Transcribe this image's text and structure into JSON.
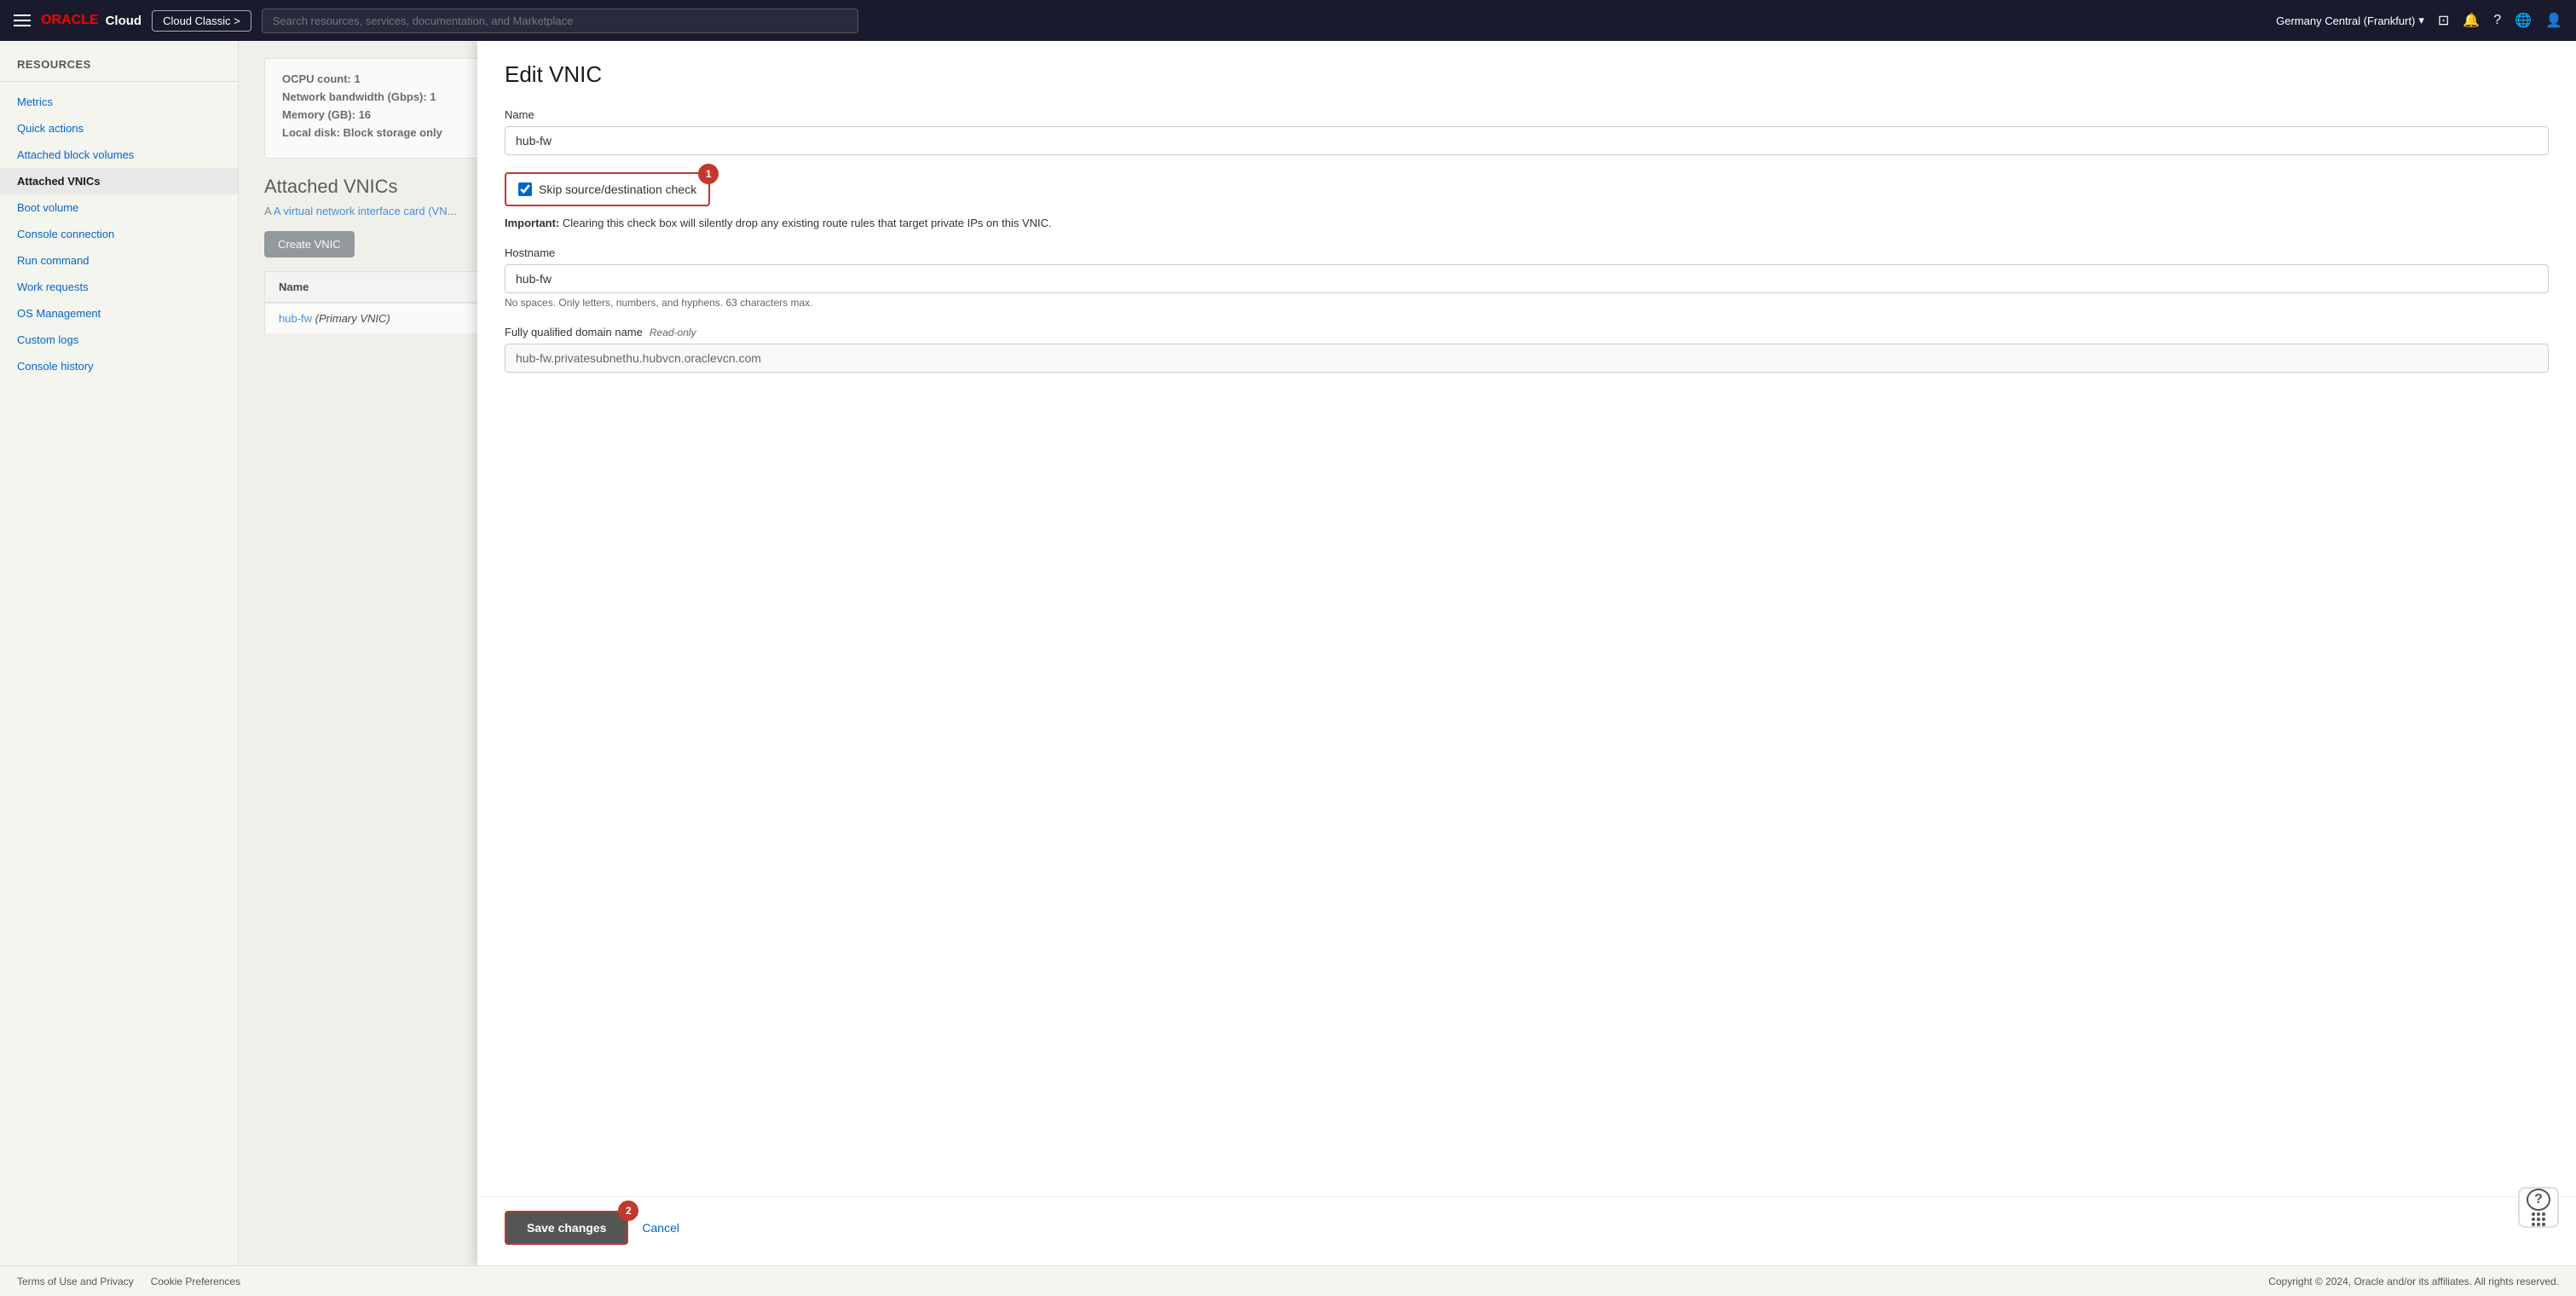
{
  "topNav": {
    "hamburger_label": "Menu",
    "oracle_text": "ORACLE",
    "cloud_text": "Cloud",
    "cloud_classic_btn": "Cloud Classic >",
    "search_placeholder": "Search resources, services, documentation, and Marketplace",
    "region": "Germany Central (Frankfurt)",
    "region_chevron": "▾"
  },
  "sidebar": {
    "resources_label": "Resources",
    "items": [
      {
        "id": "metrics",
        "label": "Metrics",
        "active": false
      },
      {
        "id": "quick-actions",
        "label": "Quick actions",
        "active": false
      },
      {
        "id": "attached-block-volumes",
        "label": "Attached block volumes",
        "active": false
      },
      {
        "id": "attached-vnics",
        "label": "Attached VNICs",
        "active": true
      },
      {
        "id": "boot-volume",
        "label": "Boot volume",
        "active": false
      },
      {
        "id": "console-connection",
        "label": "Console connection",
        "active": false
      },
      {
        "id": "run-command",
        "label": "Run command",
        "active": false
      },
      {
        "id": "work-requests",
        "label": "Work requests",
        "active": false
      },
      {
        "id": "os-management",
        "label": "OS Management",
        "active": false
      },
      {
        "id": "custom-logs",
        "label": "Custom logs",
        "active": false
      },
      {
        "id": "console-history",
        "label": "Console history",
        "active": false
      }
    ]
  },
  "bgContent": {
    "ocpu_label": "OCPU count:",
    "ocpu_value": "1",
    "network_label": "Network bandwidth (Gbps):",
    "network_value": "1",
    "memory_label": "Memory (GB):",
    "memory_value": "16",
    "local_disk_label": "Local disk:",
    "local_disk_value": "Block storage only",
    "attached_vnics_title": "Attached VNICs",
    "attached_vnics_desc": "A virtual network interface card (VN...",
    "create_vnic_btn": "Create VNIC",
    "table_col_name": "Name",
    "vnic_name": "hub-fw",
    "vnic_type": "(Primary VNIC)"
  },
  "editPanel": {
    "title": "Edit VNIC",
    "name_label": "Name",
    "name_value": "hub-fw",
    "skip_check_label": "Skip source/destination check",
    "skip_checked": true,
    "important_text": "Clearing this check box will silently drop any existing route rules that target private IPs on this VNIC.",
    "hostname_label": "Hostname",
    "hostname_value": "hub-fw",
    "hostname_hint": "No spaces. Only letters, numbers, and hyphens. 63 characters max.",
    "fqdn_label": "Fully qualified domain name",
    "fqdn_readonly": "Read-only",
    "fqdn_value": "hub-fw.privatesubnethu.hubvcn.oraclevcn.com",
    "save_btn": "Save changes",
    "cancel_btn": "Cancel",
    "step1_badge": "1",
    "step2_badge": "2"
  },
  "footer": {
    "copyright": "Copyright © 2024, Oracle and/or its affiliates. All rights reserved.",
    "terms_link": "Terms of Use and Privacy",
    "cookies_link": "Cookie Preferences"
  }
}
